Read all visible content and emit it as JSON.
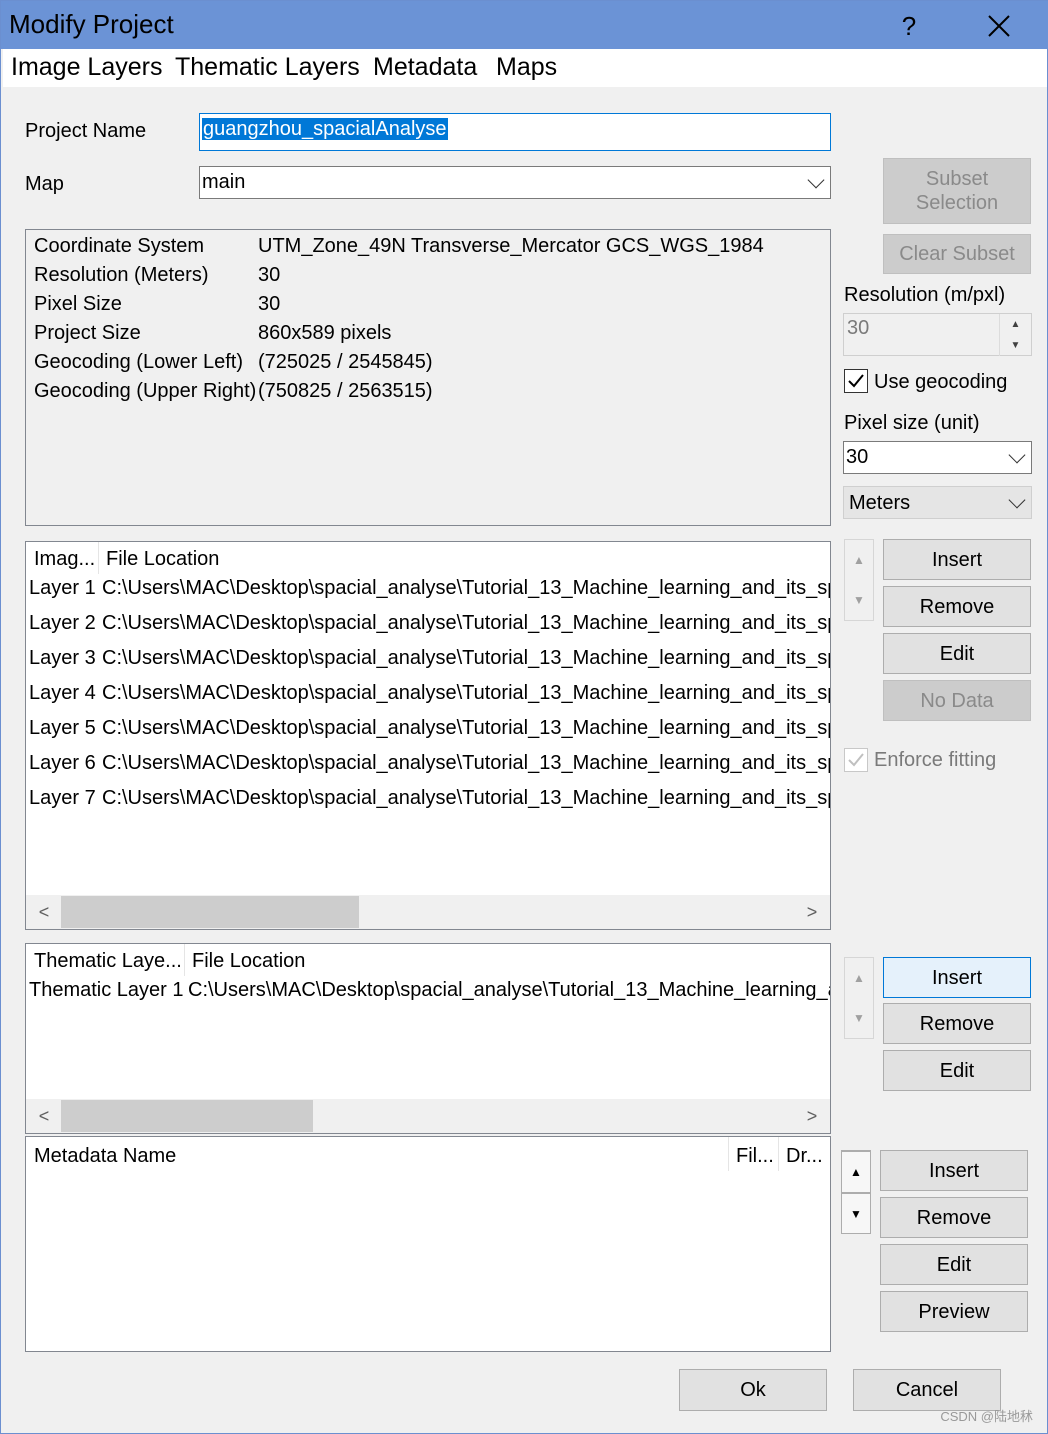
{
  "window": {
    "title": "Modify Project",
    "help_glyph": "?",
    "close_glyph": "✕"
  },
  "menu": [
    "Image Layers",
    "Thematic Layers",
    "Metadata",
    "Maps"
  ],
  "form": {
    "project_name_label": "Project Name",
    "project_name_value": "guangzhou_spacialAnalyse",
    "map_label": "Map",
    "map_value": "main"
  },
  "info": [
    {
      "key": "Coordinate System",
      "value": "UTM_Zone_49N  Transverse_Mercator  GCS_WGS_1984"
    },
    {
      "key": "Resolution (Meters)",
      "value": "30"
    },
    {
      "key": "Pixel Size",
      "value": "30"
    },
    {
      "key": "Project Size",
      "value": "860x589 pixels"
    },
    {
      "key": "Geocoding (Lower Left)",
      "value": "(725025 / 2545845)"
    },
    {
      "key": "Geocoding (Upper Right)",
      "value": "(750825 / 2563515)"
    }
  ],
  "right_panel": {
    "subset_selection": "Subset Selection",
    "clear_subset": "Clear Subset",
    "resolution_label": "Resolution (m/pxl)",
    "resolution_value": "30",
    "use_geocoding_label": "Use geocoding",
    "use_geocoding_checked": true,
    "pixel_size_label": "Pixel size (unit)",
    "pixel_size_value": "30",
    "unit_value": "Meters"
  },
  "image_layers": {
    "headers": [
      "Imag...",
      "File Location"
    ],
    "rows": [
      {
        "name": "Layer 1",
        "path": "C:\\Users\\MAC\\Desktop\\spacial_analyse\\Tutorial_13_Machine_learning_and_its_sp"
      },
      {
        "name": "Layer 2",
        "path": "C:\\Users\\MAC\\Desktop\\spacial_analyse\\Tutorial_13_Machine_learning_and_its_sp"
      },
      {
        "name": "Layer 3",
        "path": "C:\\Users\\MAC\\Desktop\\spacial_analyse\\Tutorial_13_Machine_learning_and_its_sp"
      },
      {
        "name": "Layer 4",
        "path": "C:\\Users\\MAC\\Desktop\\spacial_analyse\\Tutorial_13_Machine_learning_and_its_sp"
      },
      {
        "name": "Layer 5",
        "path": "C:\\Users\\MAC\\Desktop\\spacial_analyse\\Tutorial_13_Machine_learning_and_its_sp"
      },
      {
        "name": "Layer 6",
        "path": "C:\\Users\\MAC\\Desktop\\spacial_analyse\\Tutorial_13_Machine_learning_and_its_sp"
      },
      {
        "name": "Layer 7",
        "path": "C:\\Users\\MAC\\Desktop\\spacial_analyse\\Tutorial_13_Machine_learning_and_its_sp"
      }
    ],
    "buttons": {
      "insert": "Insert",
      "remove": "Remove",
      "edit": "Edit",
      "no_data": "No Data"
    },
    "enforce_fitting_label": "Enforce fitting",
    "enforce_fitting_checked": true
  },
  "thematic_layers": {
    "headers": [
      "Thematic Laye...",
      "File Location"
    ],
    "rows": [
      {
        "name": "Thematic Layer 1",
        "path": "C:\\Users\\MAC\\Desktop\\spacial_analyse\\Tutorial_13_Machine_learning_a"
      }
    ],
    "buttons": {
      "insert": "Insert",
      "remove": "Remove",
      "edit": "Edit"
    }
  },
  "metadata": {
    "headers": [
      "Metadata Name",
      "Fil...",
      "Dr..."
    ],
    "buttons": {
      "insert": "Insert",
      "remove": "Remove",
      "edit": "Edit",
      "preview": "Preview"
    }
  },
  "footer": {
    "ok": "Ok",
    "cancel": "Cancel"
  },
  "watermark": "CSDN @陆地秫"
}
